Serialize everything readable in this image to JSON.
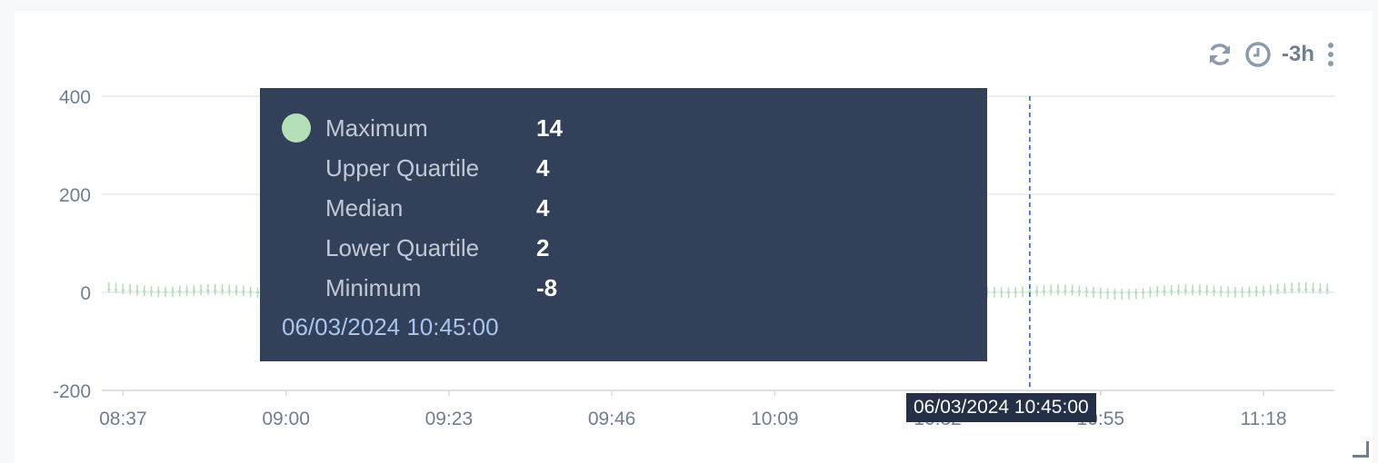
{
  "toolbar": {
    "refresh_icon": "refresh-icon",
    "clock_icon": "clock-icon",
    "range_label": "-3h",
    "menu_icon": "vertical-ellipsis-icon"
  },
  "tooltip": {
    "rows": [
      {
        "label": "Maximum",
        "value": "14"
      },
      {
        "label": "Upper Quartile",
        "value": "4"
      },
      {
        "label": "Median",
        "value": "4"
      },
      {
        "label": "Lower Quartile",
        "value": "2"
      },
      {
        "label": "Minimum",
        "value": "-8"
      }
    ],
    "timestamp": "06/03/2024 10:45:00",
    "series_color": "#b5dfb7"
  },
  "crosshair_label": "06/03/2024 10:45:00",
  "chart_data": {
    "type": "boxplot",
    "title": "",
    "xlabel": "",
    "ylabel": "",
    "ylim": [
      -200,
      400
    ],
    "yticks": [
      400,
      200,
      0,
      -200
    ],
    "xticks": [
      "08:37",
      "09:00",
      "09:23",
      "09:46",
      "10:09",
      "10:32",
      "10:55",
      "11:18"
    ],
    "x_range": [
      "08:34",
      "11:28"
    ],
    "grid": true,
    "series_color": "#b5dfb7",
    "crosshair_time": "10:45",
    "highlighted_point": {
      "time": "10:45",
      "maximum": 14,
      "upper_quartile": 4,
      "median": 4,
      "lower_quartile": 2,
      "minimum": -8
    },
    "typical_point": {
      "maximum": 14,
      "upper_quartile": 4,
      "median": 4,
      "lower_quartile": 2,
      "minimum": -8
    }
  }
}
